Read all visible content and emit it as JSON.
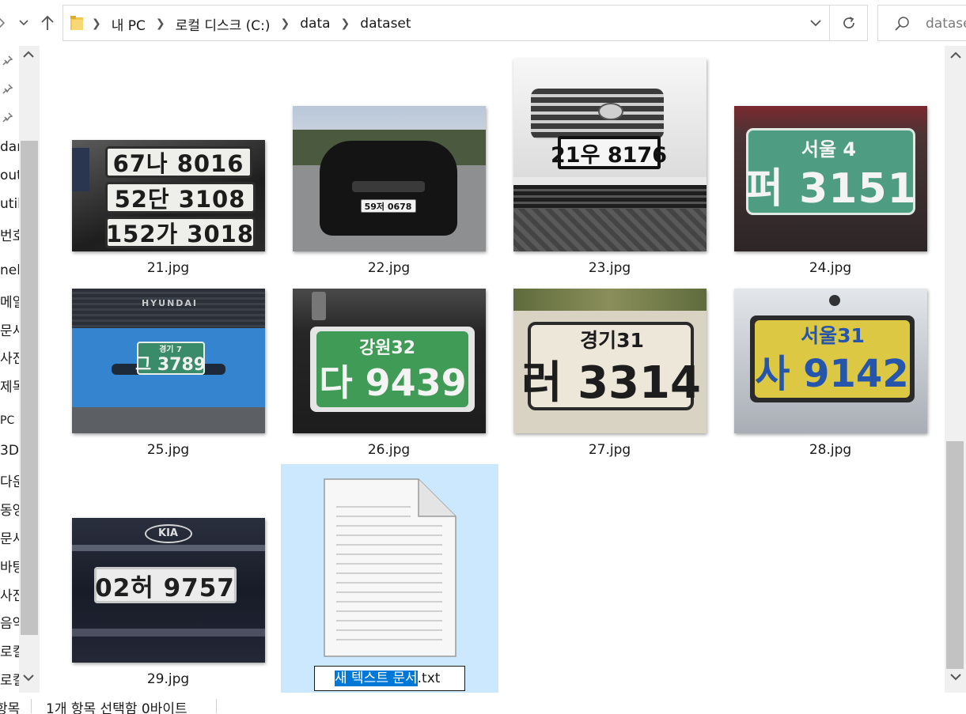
{
  "address": {
    "crumbs": [
      "내 PC",
      "로컬 디스크 (C:)",
      "data",
      "dataset"
    ]
  },
  "search": {
    "placeholder": "dataset"
  },
  "nav": {
    "items": [
      "dan",
      "out",
      "util",
      "번호",
      "nel",
      "메일",
      "문서",
      "사진",
      "제목",
      "PC",
      "3D",
      "다운",
      "동영",
      "문서",
      "바탕",
      "사진",
      "음악",
      "로컬",
      "로컬"
    ]
  },
  "files": [
    {
      "name": "21.jpg",
      "plates": [
        "67나 8016",
        "52단 3108",
        "152가 3018"
      ]
    },
    {
      "name": "22.jpg",
      "plates": [
        "59저 0678"
      ]
    },
    {
      "name": "23.jpg",
      "plates": [
        "21우 8176"
      ]
    },
    {
      "name": "24.jpg",
      "plate_top": "서울 4",
      "plate_bottom": "퍼 3151"
    },
    {
      "name": "25.jpg",
      "plate_top": "경기 7",
      "plate_bottom": "그 3789",
      "brand": "HYUNDAI"
    },
    {
      "name": "26.jpg",
      "plate_top": "강원32",
      "plate_bottom": "다 9439"
    },
    {
      "name": "27.jpg",
      "plate_top": "경기31",
      "plate_bottom": "러 3314"
    },
    {
      "name": "28.jpg",
      "plate_top": "서울31",
      "plate_bottom": "사 9142"
    },
    {
      "name": "29.jpg",
      "plates": [
        "02허 9757"
      ],
      "brand": "KIA"
    }
  ],
  "new_file": {
    "selected_part": "새 텍스트 문서",
    "extension": ".txt"
  },
  "status": {
    "count": "항목",
    "selection": "1개 항목 선택함 0바이트"
  },
  "colors": {
    "selection_bg": "#cce8ff",
    "rename_highlight": "#0078d7",
    "folder": "#f3c64d"
  }
}
